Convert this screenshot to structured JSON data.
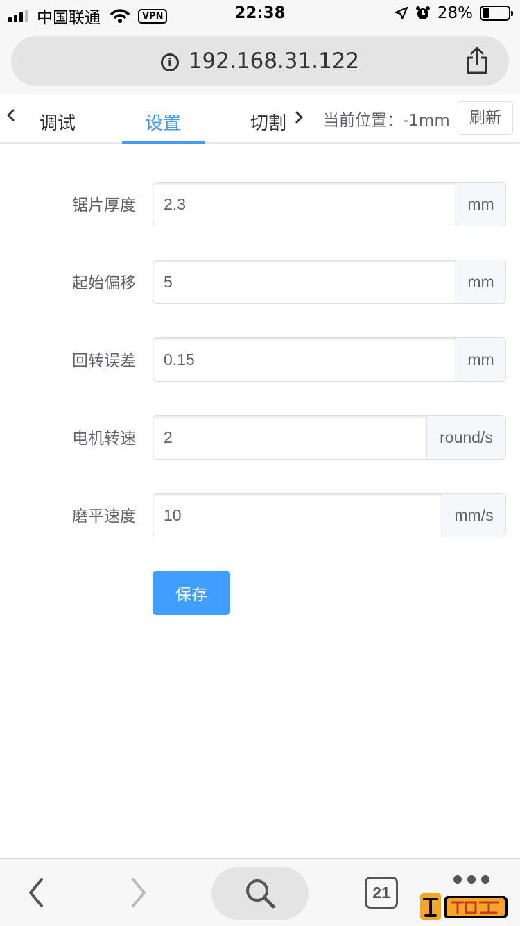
{
  "status_bar": {
    "carrier": "中国联通",
    "vpn": "VPN",
    "time": "22:38",
    "battery": "28%",
    "battery_level": 0.28
  },
  "browser": {
    "url": "192.168.31.122"
  },
  "tabs": {
    "items": [
      {
        "label": "调试",
        "active": false
      },
      {
        "label": "设置",
        "active": true
      },
      {
        "label": "切割",
        "active": false
      }
    ],
    "position_label": "当前位置：-1mm",
    "refresh_label": "刷新"
  },
  "form": {
    "fields": [
      {
        "label": "锯片厚度",
        "value": "2.3",
        "unit": "mm"
      },
      {
        "label": "起始偏移",
        "value": "5",
        "unit": "mm"
      },
      {
        "label": "回转误差",
        "value": "0.15",
        "unit": "mm"
      },
      {
        "label": "电机转速",
        "value": "2",
        "unit": "round/s"
      },
      {
        "label": "磨平速度",
        "value": "10",
        "unit": "mm/s"
      }
    ],
    "save_label": "保存"
  },
  "toolbar": {
    "tab_count": "21",
    "watermark": "太平洋电脑网 爱好者"
  },
  "colors": {
    "accent": "#409eff",
    "text": "#606266",
    "border": "#dcdfe6"
  }
}
